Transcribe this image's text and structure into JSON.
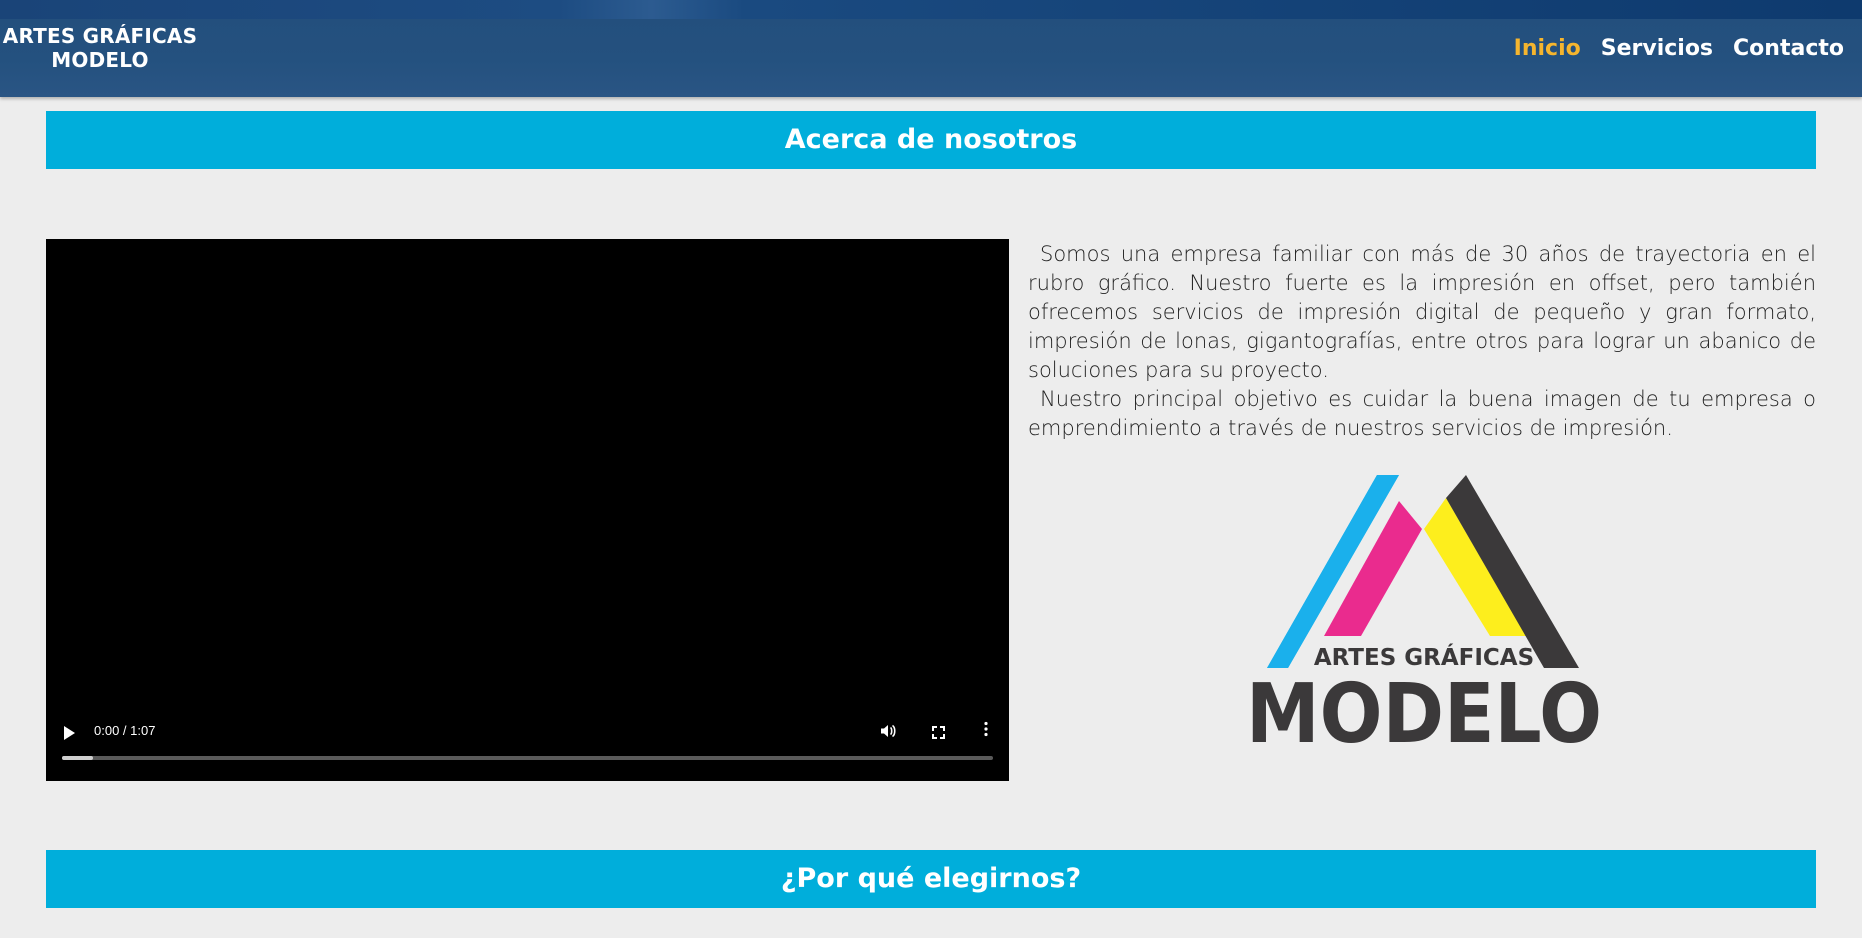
{
  "header": {
    "brand_line1": "ARTES GRÁFICAS",
    "brand_line2": "MODELO",
    "nav": [
      {
        "label": "Inicio",
        "active": true
      },
      {
        "label": "Servicios",
        "active": false
      },
      {
        "label": "Contacto",
        "active": false
      }
    ]
  },
  "about": {
    "title": "Acerca de nosotros",
    "paragraphs": [
      "Somos una empresa familiar con más de 30 años de trayectoria en el rubro gráfico. Nuestro fuerte es la impresión en offset, pero también ofrecemos servicios de impresión digital de pequeño y gran formato, impresión de lonas, gigantografías, entre otros para lograr un abanico de soluciones para su proyecto.",
      " Nuestro principal objetivo es cuidar la buena imagen de tu empresa o emprendimiento a través de nuestros servicios de impresión."
    ],
    "video": {
      "time": "0:00 / 1:07",
      "progress": 0.033
    },
    "logo": {
      "line1": "ARTES GRÁFICAS",
      "line2": "MODELO",
      "colors": [
        "#1ab0ec",
        "#ea2b8e",
        "#fdee1d",
        "#3b393a"
      ]
    }
  },
  "why": {
    "title": "¿Por qué elegirnos?"
  },
  "colors": {
    "header_bg": "#24517f",
    "accent_cyan": "#00aedb",
    "nav_active": "#f5b52e",
    "page_bg": "#ededed"
  }
}
